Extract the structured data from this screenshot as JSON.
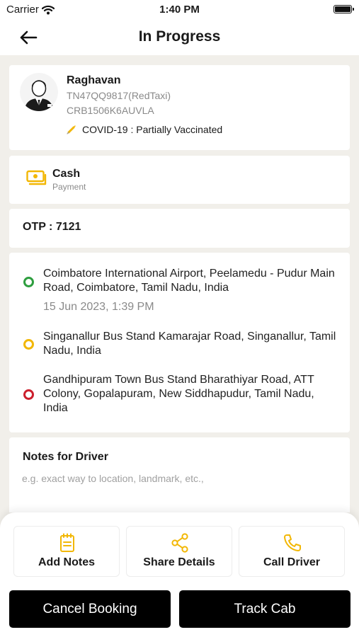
{
  "status_bar": {
    "carrier": "Carrier",
    "time": "1:40 PM"
  },
  "header": {
    "title": "In Progress"
  },
  "driver": {
    "name": "Raghavan",
    "vehicle": "TN47QQ9817(RedTaxi)",
    "booking_id": "CRB1506K6AUVLA",
    "covid_status": "COVID-19 : Partially Vaccinated"
  },
  "payment": {
    "method": "Cash",
    "label": "Payment"
  },
  "otp": "OTP : 7121",
  "route": {
    "pickup": {
      "address": "Coimbatore International Airport, Peelamedu - Pudur Main Road, Coimbatore, Tamil Nadu, India",
      "time": "15 Jun 2023, 1:39 PM"
    },
    "stop": {
      "address": "Singanallur Bus Stand Kamarajar Road, Singanallur, Tamil Nadu, India"
    },
    "drop": {
      "address": "Gandhipuram Town Bus Stand Bharathiyar Road, ATT Colony, Gopalapuram, New Siddhapudur, Tamil Nadu, India"
    }
  },
  "notes": {
    "title": "Notes for Driver",
    "placeholder": "e.g. exact way to location, landmark, etc.,",
    "value": ""
  },
  "actions": {
    "add_notes": "Add Notes",
    "share_details": "Share Details",
    "call_driver": "Call Driver",
    "cancel_booking": "Cancel Booking",
    "track_cab": "Track Cab"
  },
  "colors": {
    "accent": "#f2b705",
    "pickup_dot": "#2e9e3f",
    "stop_dot": "#f2b705",
    "drop_dot": "#cc1f2d",
    "button_bg": "#000000"
  }
}
